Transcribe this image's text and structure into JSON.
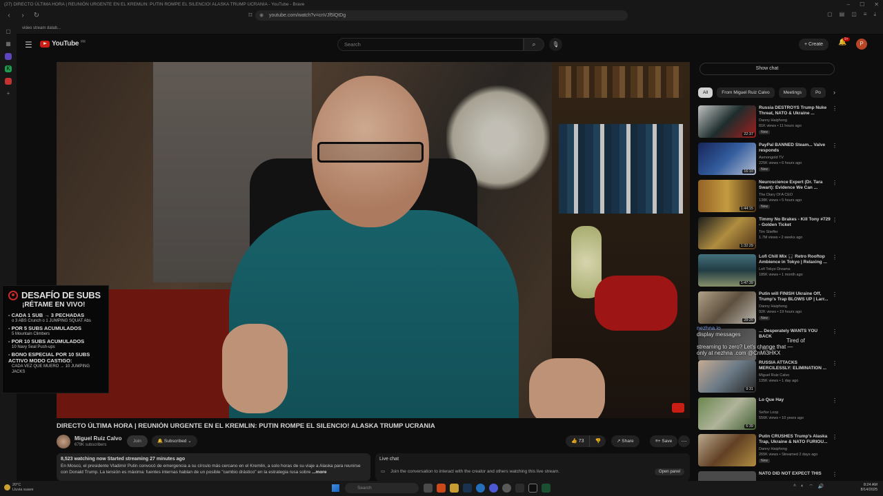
{
  "browser": {
    "window_title": "(27) DIRECTO ÚLTIMA HORA | REUNIÓN URGENTE EN EL KREMLIN: PUTIN ROMPE EL SILENCIO! ALASKA TRUMP UCRANIA - YouTube - Brave",
    "url": "youtube.com/watch?v=cnVJf5lQtDg",
    "bookmark": "video stream datab..."
  },
  "youtube": {
    "logo_text": "YouTube",
    "logo_region": "FR",
    "search_placeholder": "Search",
    "create_label": "Create",
    "notification_count": "9+",
    "avatar_letter": "P"
  },
  "overlay": {
    "title": "DESAFÍO DE SUBS",
    "subtitle": "¡RÉTAME EN VIVO!",
    "rules": [
      {
        "line": "- CADA 1 SUB → 3 PECHADAS",
        "small": "o 3 ABS Crunch o 1 JUMPING SQUAT Abs"
      },
      {
        "line": "- POR 5 SUBS ACUMULADOS",
        "small": "5 Mountain Climbers"
      },
      {
        "line": "- POR 10 SUBS ACUMULADOS",
        "small": "10 Navy Seal Push-ups"
      },
      {
        "line": "- BONO ESPECIAL POR 10 SUBS ACTIVO MODO CASTIGO:",
        "small": "CADA VEZ QUE MUERO → 10 JUMPING JACKS"
      }
    ]
  },
  "video": {
    "title": "DIRECTO ÚLTIMA HORA | REUNIÓN URGENTE EN EL KREMLIN: PUTIN ROMPE EL SILENCIO! ALASKA TRUMP UCRANIA",
    "channel": "Miguel Ruiz Calvo",
    "subscribers": "679K subscribers",
    "join_label": "Join",
    "subscribed_label": "Subscribed",
    "likes": "73",
    "share_label": "Share",
    "save_label": "Save",
    "stats": "8,523 watching now  Started streaming 27 minutes ago",
    "description": "En Moscú, el presidente Vladimir Putin convocó de emergencia a su círculo más cercano en el Kremlin, a solo horas de su viaje a Alaska para reunirse con Donald Trump. La tensión es máxima: fuentes internas hablan de un posible \"cambio drástico\" en la estrategia rusa sobre",
    "more_label": "...more"
  },
  "livechat": {
    "title": "Live chat",
    "prompt": "Join the conversation to interact with the creator and others watching this live stream.",
    "open_label": "Open panel"
  },
  "sidebar": {
    "show_chat": "Show chat",
    "chips": [
      "All",
      "From Miguel Ruiz Calvo",
      "Meetings",
      "Po"
    ],
    "recs": [
      {
        "title": "Russia DESTROYS Trump Nuke Threat, NATO & Ukraine ...",
        "channel": "Danny Haiphong",
        "meta": "81K views • 11 hours ago",
        "duration": "22:37",
        "new": "New"
      },
      {
        "title": "PayPal BANNED Steam... Valve responds",
        "channel": "Asmongold TV",
        "meta": "225K views • 6 hours ago",
        "duration": "16:10",
        "new": "New"
      },
      {
        "title": "Neuroscience Expert (Dr. Tara Swart): Evidence We Can ...",
        "channel": "The Diary Of A CEO",
        "meta": "138K views • 5 hours ago",
        "duration": "1:44:15",
        "new": "New"
      },
      {
        "title": "Timmy No Brakes - Kill Tony #729 - Golden Ticket",
        "channel": "Tim Stieffer",
        "meta": "1.7M views • 2 weeks ago",
        "duration": "1:32:29",
        "new": ""
      },
      {
        "title": "Lofi Chill Mix 🎧 Retro Rooftop Ambience in Tokyo | Relaxing ...",
        "channel": "Lofi Tokyo Dreams",
        "meta": "185K views • 1 month ago",
        "duration": "1:47:39",
        "new": ""
      },
      {
        "title": "Putin will FINISH Ukraine Off, Trump's Trap BLOWS UP | Larr...",
        "channel": "Danny Haiphong",
        "meta": "92K views • 19 hours ago",
        "duration": "28:20",
        "new": "New"
      },
      {
        "title": "... Desperately WANTS YOU BACK",
        "channel": "",
        "meta": "1 day ago",
        "duration": "",
        "new": ""
      },
      {
        "title": "RUSSIA ATTACKS MERCILESSLY: ELIMINATION ...",
        "channel": "Miguel Ruiz Calvo",
        "meta": "135K views • 1 day ago",
        "duration": "9:31",
        "new": ""
      },
      {
        "title": "Lo Que Hay",
        "channel": "Señor Loop",
        "meta": "556K views • 10 years ago",
        "duration": "6:39",
        "new": ""
      },
      {
        "title": "Putin CRUSHES Trump's Alaska Trap, Ukraine & NATO FURIOU...",
        "channel": "Danny Haiphong",
        "meta": "265K views • Streamed 2 days ago",
        "duration": "",
        "new": "New"
      },
      {
        "title": "NATO DID NOT EXPECT THIS",
        "channel": "",
        "meta": "",
        "duration": "",
        "new": ""
      }
    ],
    "nezhna_lines": [
      "nezhna.io",
      "display messages",
      "Tired of",
      "streaming to zero? Let's change that —",
      "only at nezhna .com @CnMi3HKX"
    ]
  },
  "taskbar": {
    "temp": "20°C",
    "weather": "Lluvia suave",
    "search_placeholder": "Search",
    "time": "8:24 AM",
    "date": "8/14/2025"
  },
  "colors": {
    "yt_red": "#e62117",
    "overlay_red": "#e63030",
    "shirt": "#1c6f78"
  }
}
